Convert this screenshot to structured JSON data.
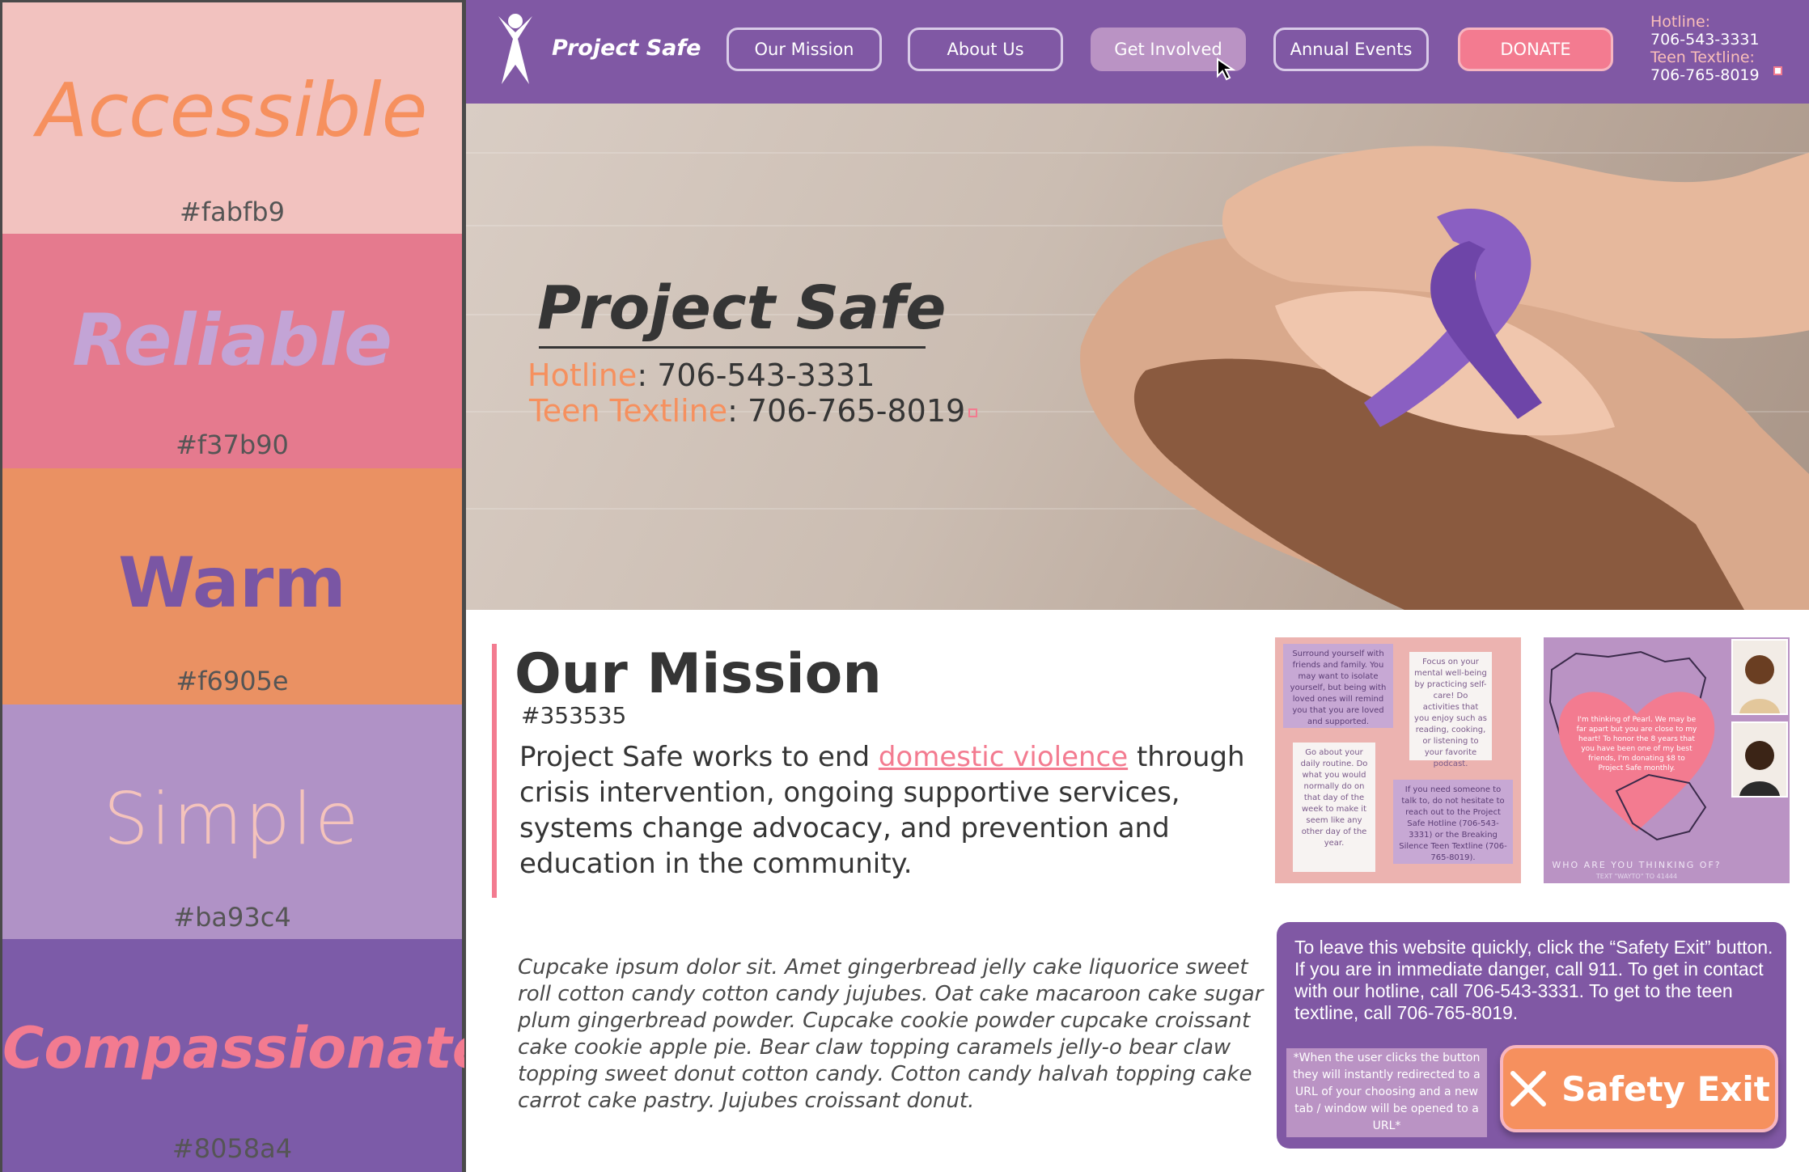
{
  "palette": [
    {
      "word": "Accessible",
      "hex": "#fabfb9",
      "bg": "#f2c2bf",
      "word_color": "#f6905e"
    },
    {
      "word": "Reliable",
      "hex": "#f37b90",
      "bg": "#e57a8e",
      "word_color": "#c3a4d6"
    },
    {
      "word": "Warm",
      "hex": "#f6905e",
      "bg": "#ea9163",
      "word_color": "#7a56a4"
    },
    {
      "word": "Simple",
      "hex": "#ba93c4",
      "bg": "#b092c6",
      "word_color": "#f4c3bc"
    },
    {
      "word": "Compassionate",
      "hex": "#8058a4",
      "bg": "#7c5ba8",
      "word_color": "#f37b90"
    }
  ],
  "nav": {
    "brand": "Project Safe",
    "items": [
      "Our Mission",
      "About Us",
      "Get Involved",
      "Annual Events"
    ],
    "active": "Get Involved",
    "donate": "DONATE",
    "hotline_label": "Hotline:",
    "hotline_number": "706-543-3331",
    "textline_label": "Teen Textline:",
    "textline_number": "706-765-8019"
  },
  "hero": {
    "title": "Project Safe",
    "hotline_label": "Hotline",
    "hotline_number": ": 706-543-3331",
    "textline_label": "Teen Textline",
    "textline_number": ": 706-765-8019"
  },
  "mission": {
    "title": "Our Mission",
    "hex": "#353535",
    "text_before": "Project Safe works to end ",
    "link": "domestic violence",
    "text_after": " through crisis intervention, ongoing supportive services, systems change advocacy, and prevention and education in the community."
  },
  "lorem": "Cupcake ipsum dolor sit. Amet gingerbread jelly cake liquorice sweet roll cotton candy cotton candy jujubes. Oat cake macaroon cake sugar plum gingerbread powder. Cupcake cookie powder cupcake croissant cake cookie apple pie. Bear claw topping caramels jelly-o bear claw topping sweet donut cotton candy. Cotton candy halvah topping cake carrot cake pastry. Jujubes croissant donut.",
  "poster1": {
    "note1": "Surround yourself with friends and family. You may want to isolate yourself, but being with loved ones will remind you that you are loved and supported.",
    "note2": "Focus on your mental well-being by practicing self-care! Do activities that you enjoy such as reading, cooking, or listening to your favorite podcast.",
    "note3": "Go about your daily routine. Do what you would normally do on that day of the week to make it seem like any other day of the year.",
    "note4": "If you need someone to talk to, do not hesitate to reach out to the Project Safe Hotline (706-543-3331) or the Breaking Silence Teen Textline (706-765-8019)."
  },
  "poster2": {
    "heart_text": "I'm thinking of Pearl. We may be far apart but you are close to my heart! To honor the 8 years that you have been one of my best friends, I'm donating $8 to Project Safe monthly.",
    "footer": "WHO ARE YOU THINKING OF?",
    "sub": "TEXT \"WAYTO\" TO 41444"
  },
  "safety": {
    "text": "To leave this website quickly, click the “Safety Exit” button. If you are in immediate danger, call 911. To get in contact with our hotline, call 706-543-3331. To get to the teen textline, call 706-765-8019.",
    "note": "*When the user clicks the button they will instantly redirected to a URL of your choosing and a new tab / window will be opened to a URL*",
    "button": "Safety Exit"
  }
}
